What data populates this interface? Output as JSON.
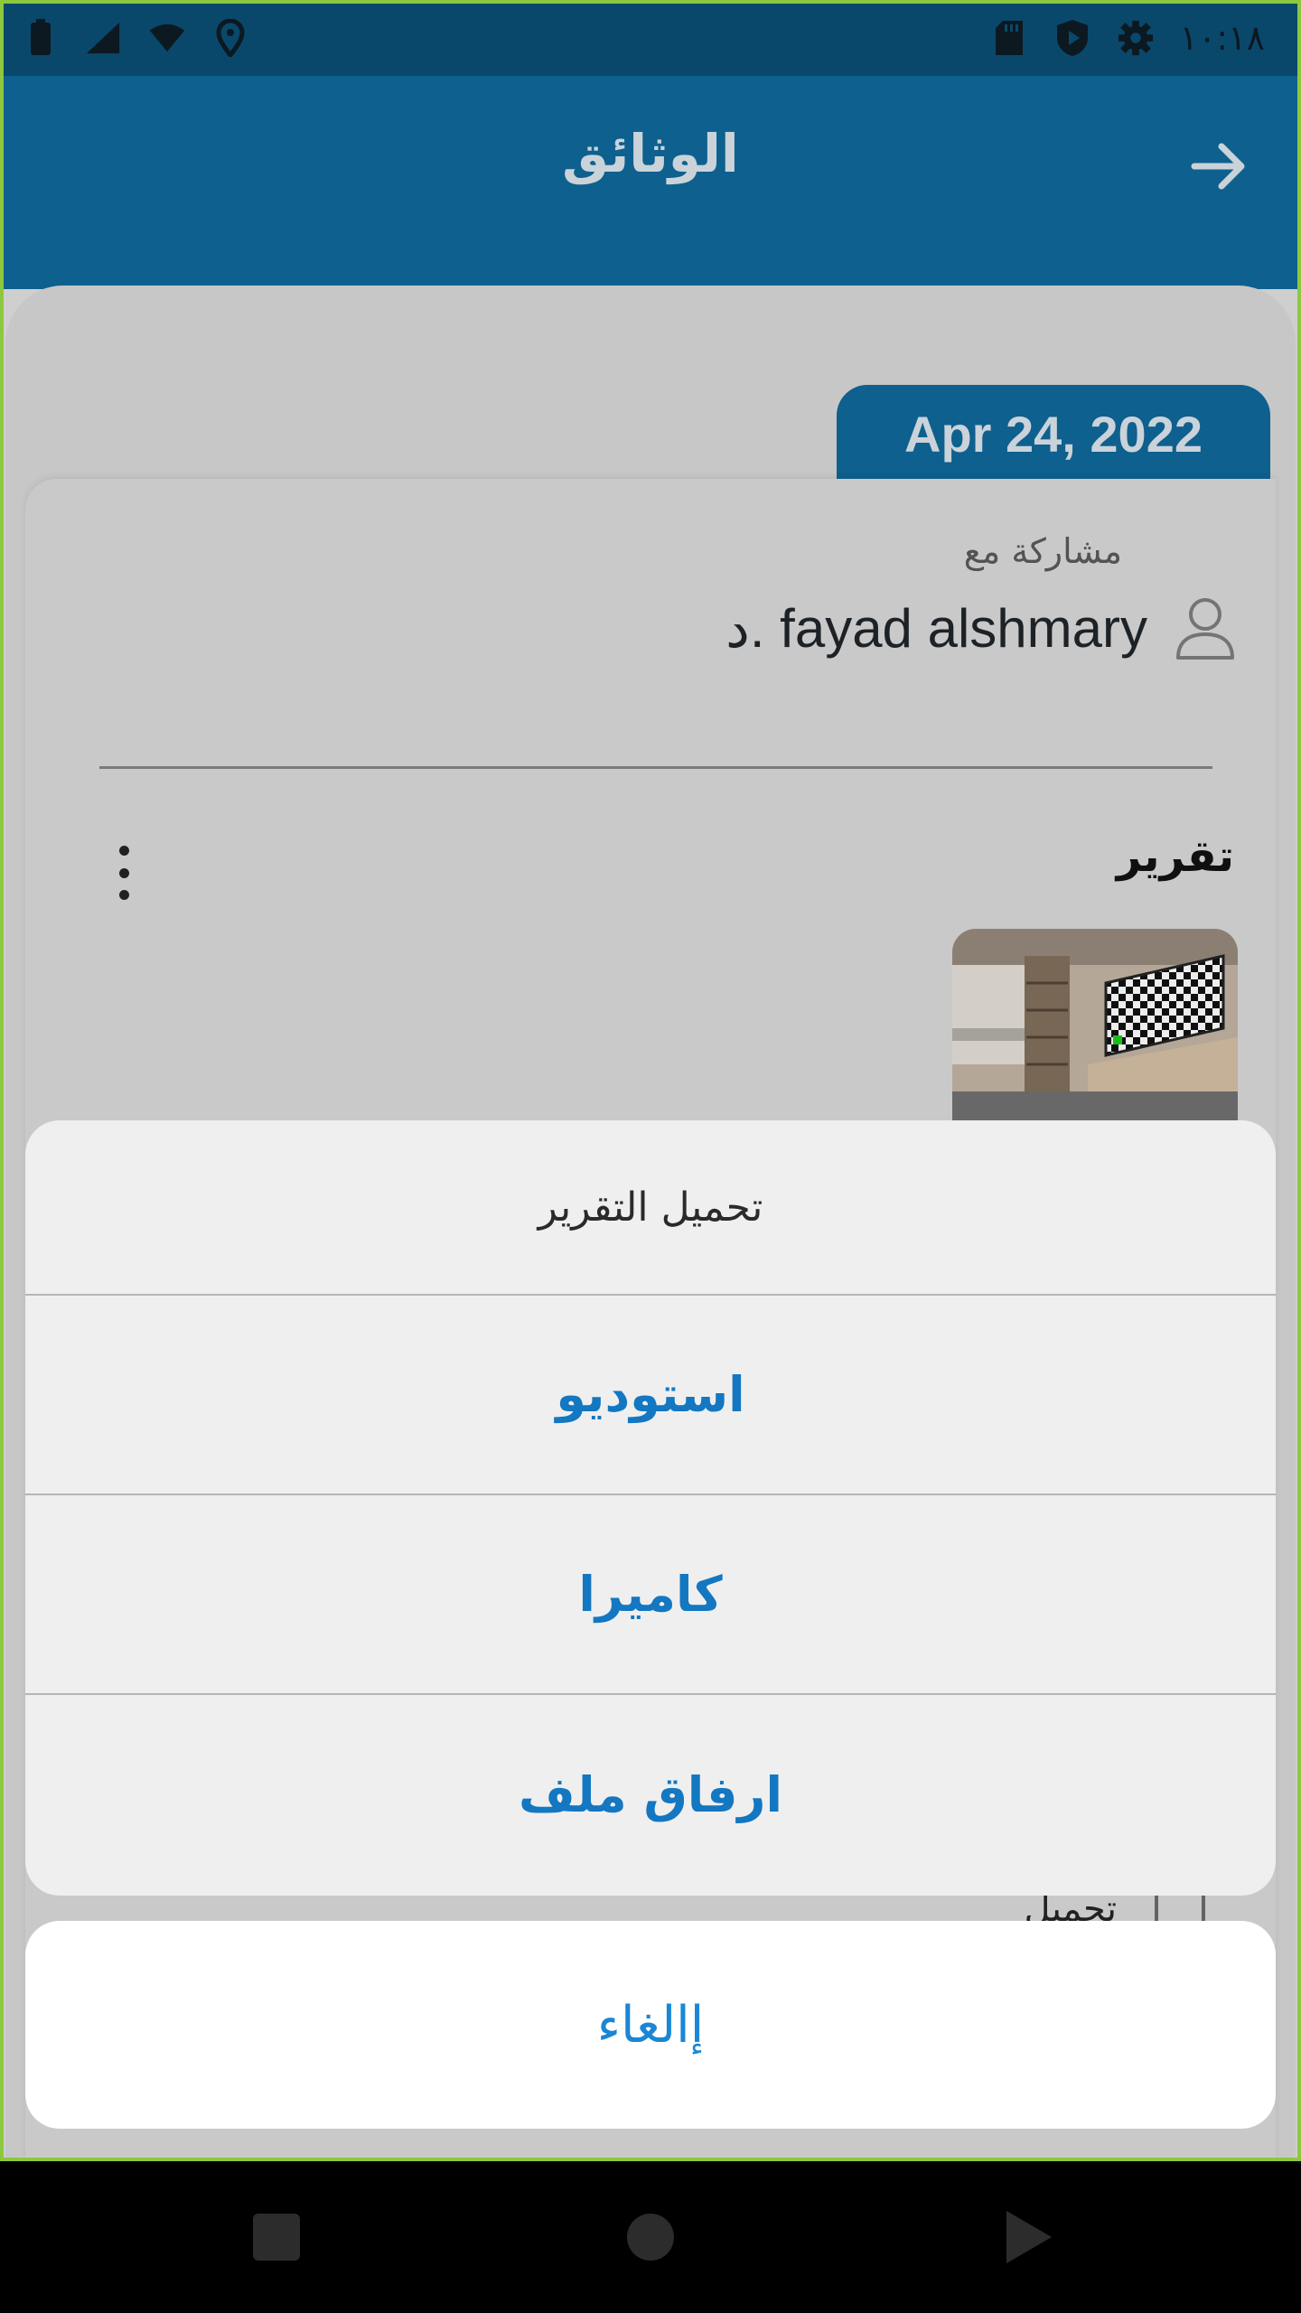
{
  "status_bar": {
    "time": "١٠:١٨",
    "left_icons": [
      "battery-icon",
      "signal-icon",
      "wifi-icon",
      "location-icon"
    ],
    "right_icons": [
      "sd-card-icon",
      "shield-icon",
      "settings-icon"
    ]
  },
  "app_bar": {
    "title": "الوثائق",
    "back_icon": "arrow-right-icon"
  },
  "document": {
    "date": "Apr 24, 2022",
    "shared_with_label": "مشاركة مع",
    "doctor_name": "د. fayad alshmary",
    "report_title": "تقرير",
    "peek_label": "تحميل"
  },
  "action_sheet": {
    "title": "تحميل التقرير",
    "options": [
      "استوديو",
      "كاميرا",
      "ارفاق ملف"
    ],
    "cancel_label": "إالغاء"
  },
  "nav_bar": {
    "icons": [
      "recents-square-icon",
      "home-circle-icon",
      "back-triangle-icon"
    ]
  },
  "colors": {
    "primary": "#0f6291",
    "status_bar": "#0b4a6e",
    "action_text": "#1377c1",
    "cancel_text": "#1a86d6"
  }
}
